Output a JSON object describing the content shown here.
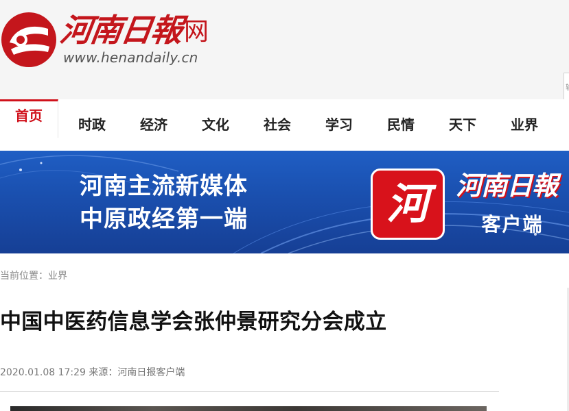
{
  "header": {
    "logo_title": "河南日報",
    "logo_suffix": "网",
    "logo_url": "www.henandaily.cn",
    "search_hint": "输"
  },
  "nav": {
    "items": [
      {
        "label": "首页",
        "active": true
      },
      {
        "label": "时政",
        "active": false
      },
      {
        "label": "经济",
        "active": false
      },
      {
        "label": "文化",
        "active": false
      },
      {
        "label": "社会",
        "active": false
      },
      {
        "label": "学习",
        "active": false
      },
      {
        "label": "民情",
        "active": false
      },
      {
        "label": "天下",
        "active": false
      },
      {
        "label": "业界",
        "active": false
      }
    ]
  },
  "banner": {
    "slogan_line1": "河南主流新媒体",
    "slogan_line2": "中原政经第一端",
    "app_icon_char": "河",
    "brand": "河南日報",
    "client_label": "客户端"
  },
  "article": {
    "breadcrumb": "当前位置：业界",
    "title": "中国中医药信息学会张仲景研究分会成立",
    "meta": "2020.01.08 17:29 来源：河南日报客户端"
  },
  "colors": {
    "brand_red": "#c4161c",
    "nav_active": "#d0111b",
    "banner_blue": "#1a4fae"
  }
}
